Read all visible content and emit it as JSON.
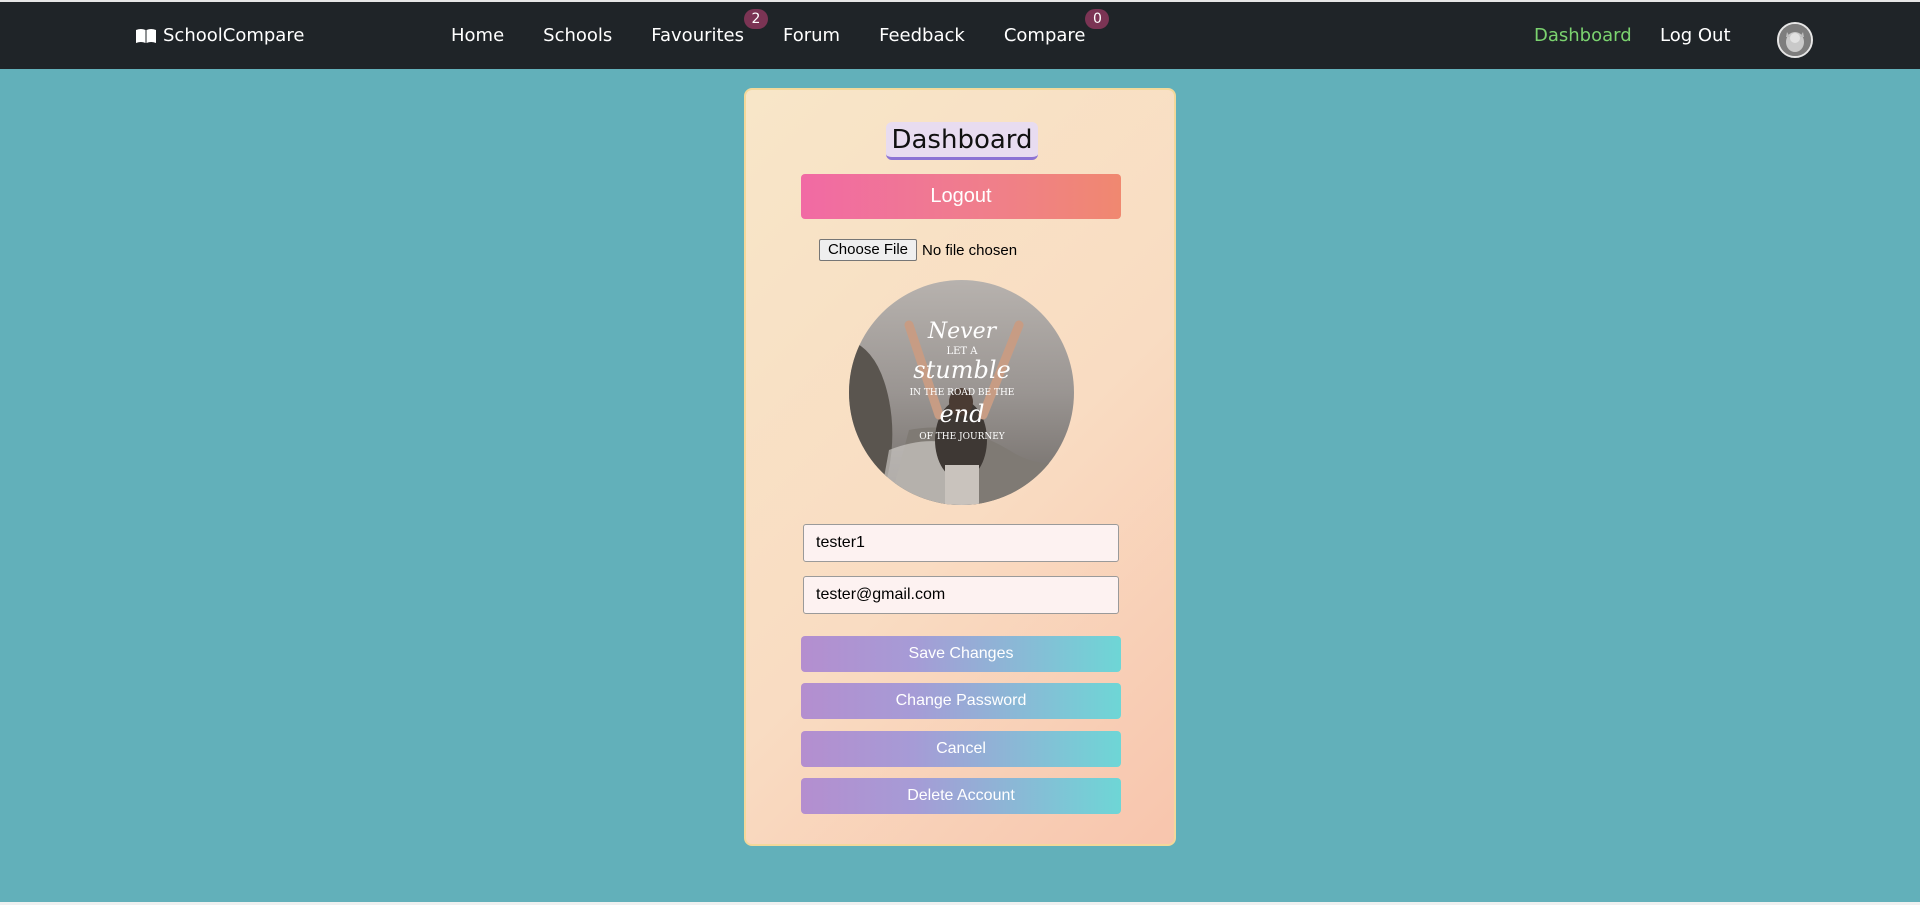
{
  "navbar": {
    "brand": "SchoolCompare",
    "brand_icon": "open-book-icon",
    "links": [
      {
        "label": "Home"
      },
      {
        "label": "Schools"
      },
      {
        "label": "Favourites",
        "badge": "2"
      },
      {
        "label": "Forum"
      },
      {
        "label": "Feedback"
      },
      {
        "label": "Compare",
        "badge": "0"
      }
    ],
    "dashboard_label": "Dashboard",
    "logout_label": "Log Out",
    "avatar_icon": "user-avatar",
    "active_color": "#7bd36f",
    "badge_color": "#7b3454"
  },
  "card": {
    "title": "Dashboard",
    "logout_button": "Logout",
    "file_input": {
      "button_label": "Choose File",
      "status": "No file chosen"
    },
    "profile_image": {
      "quote_lines": [
        "Never",
        "LET A",
        "stumble",
        "IN THE ROAD BE THE",
        "end",
        "OF THE JOURNEY"
      ]
    },
    "username": "tester1",
    "email": "tester@gmail.com",
    "buttons": {
      "save": "Save Changes",
      "change_password": "Change Password",
      "cancel": "Cancel",
      "delete": "Delete Account"
    }
  },
  "colors": {
    "navbar_bg": "#1f2428",
    "page_bg": "#62b0ba",
    "logout_gradient": [
      "#f16aa4",
      "#f08870"
    ],
    "action_gradient": [
      "#b48ecf",
      "#6ed6d6"
    ]
  }
}
